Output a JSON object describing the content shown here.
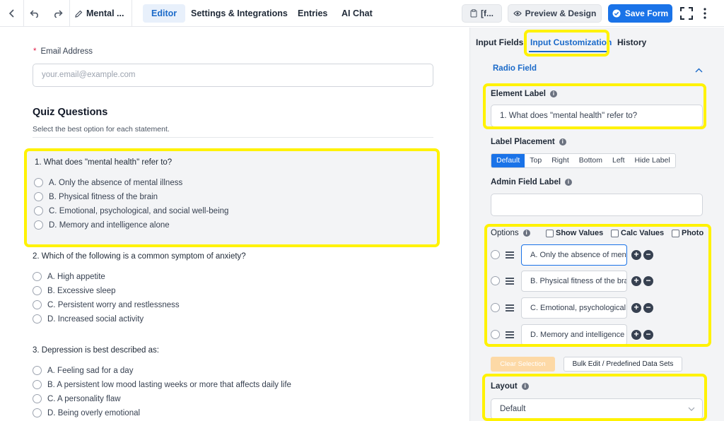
{
  "topbar": {
    "form_title": "Mental ...",
    "tabs": [
      {
        "label": "Editor",
        "active": true
      },
      {
        "label": "Settings & Integrations",
        "active": false
      },
      {
        "label": "Entries",
        "active": false
      },
      {
        "label": "AI Chat",
        "active": false
      }
    ],
    "shortcode_label": "[f...",
    "preview_label": "Preview & Design",
    "save_label": "Save Form"
  },
  "editor": {
    "email": {
      "required_mark": "*",
      "label": "Email Address",
      "placeholder": "your.email@example.com"
    },
    "section": {
      "title": "Quiz Questions",
      "subtitle": "Select the best option for each statement."
    },
    "questions": [
      {
        "title": "1. What does \"mental health\" refer to?",
        "options": [
          "A. Only the absence of mental illness",
          "B. Physical fitness of the brain",
          "C. Emotional, psychological, and social well-being",
          "D. Memory and intelligence alone"
        ]
      },
      {
        "title": "2. Which of the following is a common symptom of anxiety?",
        "options": [
          "A. High appetite",
          "B. Excessive sleep",
          "C. Persistent worry and restlessness",
          "D. Increased social activity"
        ]
      },
      {
        "title": "3. Depression is best described as:",
        "options": [
          "A. Feeling sad for a day",
          "B. A persistent low mood lasting weeks or more that affects daily life",
          "C. A personality flaw",
          "D. Being overly emotional"
        ]
      }
    ]
  },
  "panel": {
    "tabs": [
      {
        "label": "Input Fields",
        "active": false
      },
      {
        "label": "Input Customization",
        "active": true
      },
      {
        "label": "History",
        "active": false
      }
    ],
    "field_type": "Radio Field",
    "element_label": {
      "label": "Element Label",
      "value": "1. What does \"mental health\" refer to?"
    },
    "label_placement": {
      "label": "Label Placement",
      "options": [
        "Default",
        "Top",
        "Right",
        "Bottom",
        "Left",
        "Hide Label"
      ],
      "selected": "Default"
    },
    "admin_field_label": {
      "label": "Admin Field Label",
      "value": ""
    },
    "options": {
      "label": "Options",
      "checkboxes": [
        "Show Values",
        "Calc Values",
        "Photo"
      ],
      "items": [
        "A. Only the absence of mental illness",
        "B. Physical fitness of the brain",
        "C. Emotional, psychological, and social well-being",
        "D. Memory and intelligence alone"
      ],
      "plus_symbol": "+",
      "minus_symbol": "−"
    },
    "clear_selection": "Clear Selection",
    "bulk_edit": "Bulk Edit / Predefined Data Sets",
    "layout": {
      "label": "Layout",
      "value": "Default"
    }
  },
  "colors": {
    "accent": "#1a73e8",
    "highlight": "#fff200",
    "panel_bg": "#f3f4f6"
  }
}
